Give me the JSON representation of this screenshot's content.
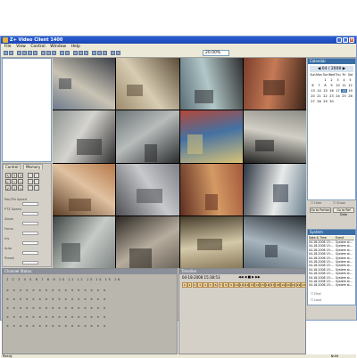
{
  "window": {
    "title": "Z+ Video Client 1400",
    "controls": [
      "_",
      "□",
      "×"
    ]
  },
  "menu": [
    "File",
    "View",
    "Control",
    "Window",
    "Help"
  ],
  "toolbar": {
    "zoom_value": "20.00%"
  },
  "ptz": {
    "tabs": [
      "Control",
      "Memory"
    ],
    "arrows": [
      "↖",
      "↑",
      "↗",
      "←",
      "•",
      "→",
      "↙",
      "↓",
      "↘"
    ],
    "rows": [
      "Pan/Tilt Speed",
      "PTZ Speed",
      "Zoom",
      "Focus",
      "Iris",
      "Auto",
      "Preset"
    ]
  },
  "cameras": [
    {
      "name": "airport-gate",
      "colors": [
        "#6d7a8c",
        "#c9c3b4",
        "#3b3f47"
      ]
    },
    {
      "name": "station-hall",
      "colors": [
        "#9c8a6a",
        "#d8cdb3",
        "#5b4c38"
      ]
    },
    {
      "name": "escalator-mall",
      "colors": [
        "#5a6e76",
        "#b2c7c8",
        "#2d2e2f"
      ]
    },
    {
      "name": "lobby-chairs",
      "colors": [
        "#7a3f2c",
        "#c57a56",
        "#3a2318"
      ]
    },
    {
      "name": "walkway",
      "colors": [
        "#8d9391",
        "#d5d4cf",
        "#2f2f2f"
      ]
    },
    {
      "name": "parking-street",
      "colors": [
        "#6c7477",
        "#b8bcbb",
        "#2a2c2e"
      ]
    },
    {
      "name": "container-yard",
      "colors": [
        "#b4473a",
        "#4471a3",
        "#d9c276"
      ]
    },
    {
      "name": "plaza-people",
      "colors": [
        "#8d8c85",
        "#d2d0c6",
        "#1e1e1e"
      ]
    },
    {
      "name": "interior-office",
      "colors": [
        "#b77849",
        "#e0c2a1",
        "#5b3c26"
      ]
    },
    {
      "name": "mall-corridor",
      "colors": [
        "#7e8087",
        "#c8c9cc",
        "#4d4f52"
      ]
    },
    {
      "name": "stadium-crowd",
      "colors": [
        "#a4593b",
        "#d49a64",
        "#5e2e22"
      ]
    },
    {
      "name": "police-car",
      "colors": [
        "#6c8190",
        "#e9ebea",
        "#2a3340"
      ]
    },
    {
      "name": "highway",
      "colors": [
        "#7f8685",
        "#c7cbc7",
        "#3d4442"
      ]
    },
    {
      "name": "shopping-floor",
      "colors": [
        "#6b6459",
        "#b7ad9e",
        "#2b2823"
      ]
    },
    {
      "name": "warehouse-interior",
      "colors": [
        "#8a7a5c",
        "#d4c9a8",
        "#453b2a"
      ]
    },
    {
      "name": "airport-check",
      "colors": [
        "#5d6c78",
        "#a9b6bf",
        "#2a3036"
      ]
    }
  ],
  "calendar": {
    "header": "Calendar",
    "month_label": "04 / 2008",
    "days": [
      "Sun",
      "Mon",
      "Tue",
      "Wed",
      "Thu",
      "Fri",
      "Sat"
    ],
    "dates": [
      "",
      "",
      "1",
      "2",
      "3",
      "4",
      "5",
      "6",
      "7",
      "8",
      "9",
      "10",
      "11",
      "12",
      "13",
      "14",
      "15",
      "16",
      "17",
      "18",
      "19",
      "20",
      "21",
      "22",
      "23",
      "24",
      "25",
      "26",
      "27",
      "28",
      "29",
      "30",
      "",
      "",
      ""
    ],
    "selected": "18",
    "checks": [
      "Hide",
      "Show"
    ],
    "buttons": [
      "Go to Portion",
      "Go to Ref Date"
    ]
  },
  "system": {
    "header": "System",
    "columns": [
      "Date & Time",
      "Event"
    ],
    "rows": [
      [
        "04-18-2008 15:...",
        "System st..."
      ],
      [
        "04-18-2008 15:...",
        "System st..."
      ],
      [
        "04-18-2008 15:...",
        "System st..."
      ],
      [
        "04-18-2008 15:...",
        "System st..."
      ],
      [
        "04-18-2008 15:...",
        "System st..."
      ],
      [
        "04-18-2008 15:...",
        "System st..."
      ],
      [
        "04-18-2008 15:...",
        "System st..."
      ],
      [
        "04-18-2008 15:...",
        "System st..."
      ],
      [
        "04-18-2008 15:...",
        "System st..."
      ],
      [
        "04-18-2008 15:...",
        "System st..."
      ],
      [
        "04-18-2008 15:...",
        "System st..."
      ],
      [
        "04-18-2008 15:...",
        "System st..."
      ]
    ],
    "checks": [
      "Find",
      "Lock"
    ]
  },
  "channel_panel": {
    "header": "Channel Status",
    "rows": [
      "1 2 3 4 5 6 7 8 9 10 11 12 13 14 15 16",
      "× × × × × × × × × × × × × × × ×",
      "× × × × × × × × × × × × × × × ×",
      "× × × × × × × × × × × × × × × ×",
      "× × × × × × × × × × × × × × × ×",
      "× × × × × × × × × × × × × × × ×"
    ]
  },
  "timeline": {
    "header": "Timeline",
    "timestamp": "04-18-2008 15:38:53",
    "hours": [
      "0",
      "1",
      "2",
      "3",
      "4",
      "5",
      "6",
      "7",
      "8",
      "9",
      "10",
      "11",
      "12",
      "13",
      "14",
      "15",
      "16",
      "17",
      "18",
      "19",
      "20",
      "21",
      "22",
      "23"
    ],
    "controls": [
      "◀◀",
      "◀",
      "■",
      "▶",
      "▶▶"
    ]
  },
  "status": {
    "left": "Ready",
    "right": "NUM"
  }
}
